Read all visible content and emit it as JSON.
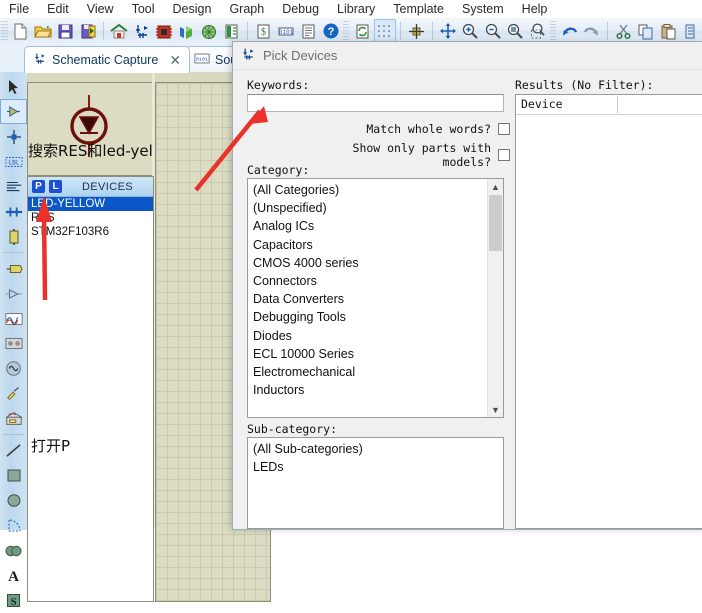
{
  "menu": {
    "items": [
      "File",
      "Edit",
      "View",
      "Tool",
      "Design",
      "Graph",
      "Debug",
      "Library",
      "Template",
      "System",
      "Help"
    ]
  },
  "toolbar": {
    "groups": [
      [
        "new-file-icon",
        "open-folder-icon",
        "save-icon",
        "save-exit-icon"
      ],
      [
        "home-icon",
        "schematic-capture-icon",
        "pcb-layout-icon",
        "3d-viewer-icon",
        "gerber-viewer-icon",
        "bom-report-icon"
      ],
      [
        "bill-of-materials-icon",
        "netlist-icon",
        "report-icon",
        "help-icon"
      ],
      [
        "refresh-icon",
        "toggle-grid-icon",
        "origin-icon"
      ],
      [
        "pan-icon",
        "zoom-in-icon",
        "zoom-out-icon",
        "zoom-all-icon",
        "zoom-area-icon"
      ],
      [
        "undo-icon",
        "redo-icon"
      ],
      [
        "cut-icon",
        "copy-icon",
        "paste-icon",
        "block-copy-icon"
      ]
    ]
  },
  "tabs": [
    {
      "label": "Schematic Capture",
      "icon": "schematic-icon",
      "closable": true,
      "selected": true
    },
    {
      "label": "Source",
      "icon": "source-icon",
      "closable": false,
      "selected": false
    }
  ],
  "vertical_tools": [
    "selection-mode-icon",
    "component-mode-icon",
    "junction-dot-icon",
    "wire-label-icon",
    "text-script-icon",
    "bus-icon",
    "subcircuit-icon",
    "terminals-mode-icon",
    "device-pin-icon",
    "graph-mode-icon",
    "tape-recorder-icon",
    "generator-mode-icon",
    "voltage-probe-icon",
    "current-probe-icon",
    "virtual-instrument-icon",
    "line-icon",
    "box-icon",
    "circle-icon",
    "arc-icon",
    "path-icon",
    "text-icon",
    "symbol-icon"
  ],
  "editor": {
    "preview_annotation": "搜索RES和led-yellow添加",
    "open_annotation": "打开P",
    "devices_panel": {
      "header": "DEVICES",
      "toggle_p": "P",
      "toggle_l": "L",
      "items": [
        {
          "label": "LED-YELLOW",
          "selected": true
        },
        {
          "label": "RES",
          "selected": false
        },
        {
          "label": "STM32F103R6",
          "selected": false
        }
      ]
    }
  },
  "dialog": {
    "title": "Pick Devices",
    "title_icon": "pick-devices-icon",
    "keywords_label": "Keywords:",
    "keywords_value": "",
    "keywords_placeholder": "",
    "match_whole_words_label": "Match whole words?",
    "match_whole_words_checked": false,
    "show_only_models_label": "Show only parts with models?",
    "show_only_models_checked": false,
    "category_label": "Category:",
    "categories": [
      "(All Categories)",
      "(Unspecified)",
      "Analog ICs",
      "Capacitors",
      "CMOS 4000 series",
      "Connectors",
      "Data Converters",
      "Debugging Tools",
      "Diodes",
      "ECL 10000 Series",
      "Electromechanical",
      "Inductors"
    ],
    "subcategory_label": "Sub-category:",
    "subcategories": [
      "(All Sub-categories)",
      "LEDs"
    ],
    "results_label": "Results (No Filter):",
    "results_columns": [
      "Device"
    ],
    "results_rows": []
  },
  "colors": {
    "accent": "#0b57c8",
    "annotation_arrow": "#e8322a",
    "schematic_bg": "#dcdcc3",
    "dialog_bg": "#f0f0f0"
  }
}
